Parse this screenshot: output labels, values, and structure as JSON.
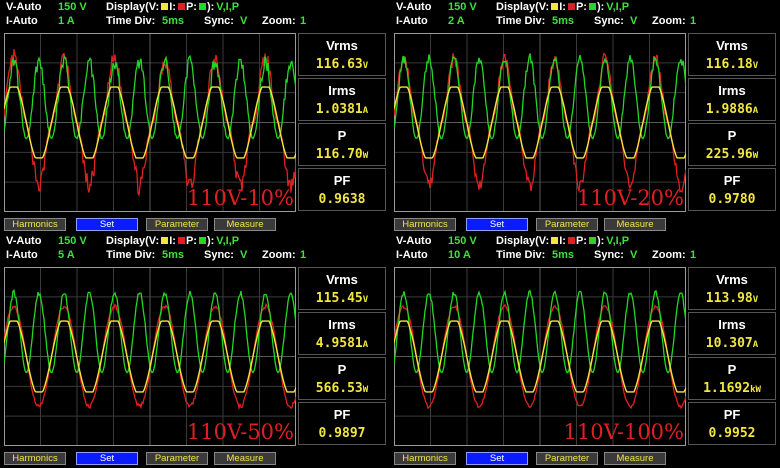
{
  "common": {
    "display_prefix": "Display(",
    "v_label": "V:",
    "i_label": "I:",
    "p_label": "P:",
    "display_suffix": "):",
    "display_value": "V,I,P",
    "time_div_label": "Time Div:",
    "sync_label": "Sync:",
    "zoom_label": "Zoom:",
    "softkeys": [
      "Harmonics",
      "Set",
      "Parameter",
      "Measure"
    ],
    "selected_softkey": "Set",
    "colors": {
      "voltage": "#f2e640",
      "current": "#e02020",
      "power": "#22d822",
      "grid": "#3a3a3a",
      "frame": "#9a9a9a"
    }
  },
  "panels": [
    {
      "v_auto_label": "V-Auto",
      "v_range": "150 V",
      "i_auto_label": "I-Auto",
      "i_range": "1 A",
      "time_div": "5ms",
      "sync": "V",
      "zoom": "1",
      "measurements": [
        {
          "label": "Vrms",
          "value": "116.63",
          "unit": "V"
        },
        {
          "label": "Irms",
          "value": "1.0381",
          "unit": "A"
        },
        {
          "label": "P",
          "value": "116.70",
          "unit": "W"
        },
        {
          "label": "PF",
          "value": "0.9638",
          "unit": ""
        }
      ],
      "overlay": "110V-10%",
      "waveform": {
        "i_amp": 0.62,
        "i_ripple": 0.22,
        "i_shape": "spiky",
        "p_amp": 0.82,
        "p_ripple": 0.16
      }
    },
    {
      "v_auto_label": "V-Auto",
      "v_range": "150 V",
      "i_auto_label": "I-Auto",
      "i_range": "2 A",
      "time_div": "5ms",
      "sync": "V",
      "zoom": "1",
      "measurements": [
        {
          "label": "Vrms",
          "value": "116.18",
          "unit": "V"
        },
        {
          "label": "Irms",
          "value": "1.9886",
          "unit": "A"
        },
        {
          "label": "P",
          "value": "225.96",
          "unit": "W"
        },
        {
          "label": "PF",
          "value": "0.9780",
          "unit": ""
        }
      ],
      "overlay": "110V-20%",
      "waveform": {
        "i_amp": 0.62,
        "i_ripple": 0.16,
        "i_shape": "spiky",
        "p_amp": 0.85,
        "p_ripple": 0.12
      }
    },
    {
      "v_auto_label": "V-Auto",
      "v_range": "150 V",
      "i_auto_label": "I-Auto",
      "i_range": "5 A",
      "time_div": "5ms",
      "sync": "V",
      "zoom": "1",
      "measurements": [
        {
          "label": "Vrms",
          "value": "115.45",
          "unit": "V"
        },
        {
          "label": "Irms",
          "value": "4.9581",
          "unit": "A"
        },
        {
          "label": "P",
          "value": "566.53",
          "unit": "W"
        },
        {
          "label": "PF",
          "value": "0.9897",
          "unit": ""
        }
      ],
      "overlay": "110V-50%",
      "waveform": {
        "i_amp": 0.56,
        "i_ripple": 0.05,
        "i_shape": "sine",
        "p_amp": 0.85,
        "p_ripple": 0.06
      }
    },
    {
      "v_auto_label": "V-Auto",
      "v_range": "150 V",
      "i_auto_label": "I-Auto",
      "i_range": "10 A",
      "time_div": "5ms",
      "sync": "V",
      "zoom": "1",
      "measurements": [
        {
          "label": "Vrms",
          "value": "113.98",
          "unit": "V"
        },
        {
          "label": "Irms",
          "value": "10.307",
          "unit": "A"
        },
        {
          "label": "P",
          "value": "1.1692",
          "unit": "kW"
        },
        {
          "label": "PF",
          "value": "0.9952",
          "unit": ""
        }
      ],
      "overlay": "110V-100%",
      "waveform": {
        "i_amp": 0.56,
        "i_ripple": 0.04,
        "i_shape": "sine",
        "p_amp": 0.85,
        "p_ripple": 0.05
      }
    }
  ]
}
